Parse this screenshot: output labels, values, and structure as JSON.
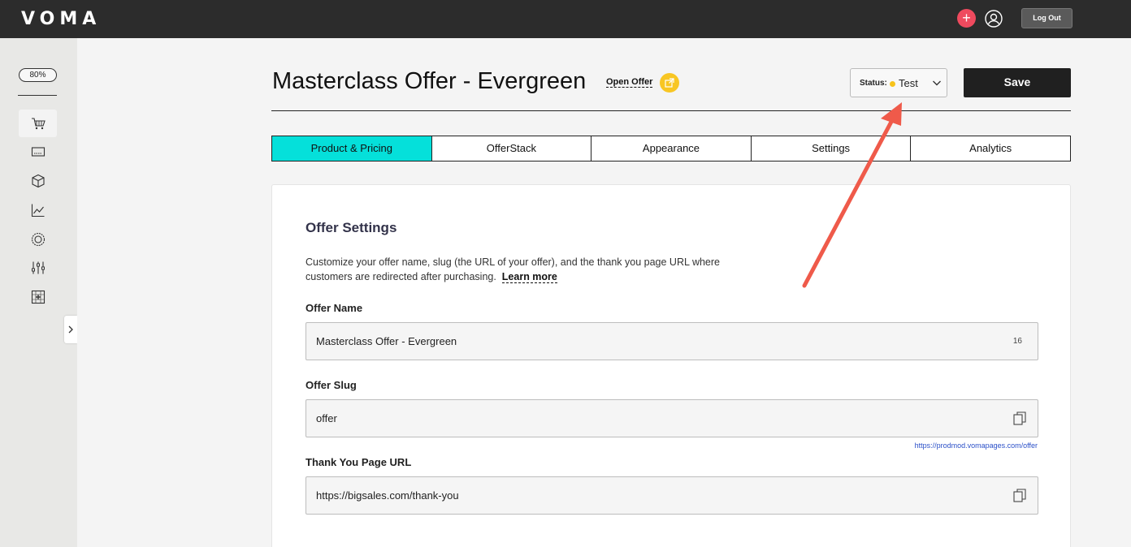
{
  "topbar": {
    "logo": "VOMA",
    "add_icon": "plus-icon",
    "user_icon": "user-icon",
    "logout_label": "Log Out"
  },
  "sidebar": {
    "zoom": "80%",
    "items": [
      {
        "icon": "cart-icon",
        "active": true
      },
      {
        "icon": "checkout-icon"
      },
      {
        "icon": "box-icon"
      },
      {
        "icon": "chart-line-icon"
      },
      {
        "icon": "badge-icon"
      },
      {
        "icon": "sliders-icon"
      },
      {
        "icon": "grid-plus-icon"
      }
    ],
    "expand_icon": "chevron-right-icon"
  },
  "header": {
    "title": "Masterclass Offer - Evergreen",
    "open_offer": "Open Offer",
    "status_label": "Status:",
    "status_value": "Test",
    "status_color": "#f7c31b",
    "save_label": "Save"
  },
  "tabs": [
    {
      "label": "Product & Pricing",
      "active": true
    },
    {
      "label": "OfferStack"
    },
    {
      "label": "Appearance"
    },
    {
      "label": "Settings"
    },
    {
      "label": "Analytics"
    }
  ],
  "offer_settings": {
    "title": "Offer Settings",
    "description": "Customize your offer name, slug (the URL of your offer), and the thank you page URL where customers are redirected after purchasing.",
    "learn_more": "Learn more",
    "offer_name_label": "Offer Name",
    "offer_name_value": "Masterclass Offer - Evergreen",
    "offer_name_count": "16",
    "offer_slug_label": "Offer Slug",
    "offer_slug_value": "offer",
    "offer_slug_url": "https://prodmod.vomapages.com/offer",
    "thank_you_label": "Thank You Page URL",
    "thank_you_value": "https://bigsales.com/thank-you"
  },
  "colors": {
    "accent_tab": "#05e0da",
    "annotation_arrow": "#ef5a4a",
    "plus_button": "#ef4a5e",
    "open_offer_icon": "#f8c623"
  }
}
